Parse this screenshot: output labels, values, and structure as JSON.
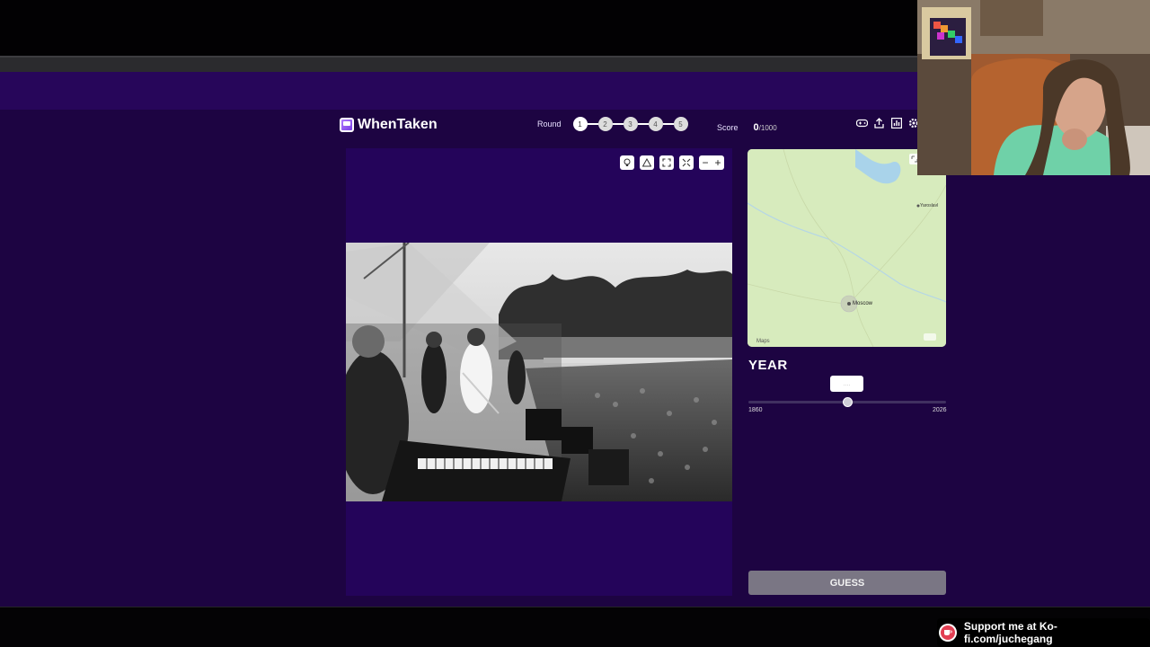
{
  "app": {
    "logo_text": "WhenTaken",
    "round_label": "Round",
    "rounds": [
      "1",
      "2",
      "3",
      "4",
      "5"
    ],
    "current_round": 1,
    "score_label": "Score",
    "score_value": "0",
    "score_max": "/1000"
  },
  "header_icons": [
    "gamepad-icon",
    "share-icon",
    "stats-icon",
    "settings-icon"
  ],
  "photo_tools": [
    "hint-icon",
    "triangle-icon",
    "expand-icon",
    "fullscreen-icon"
  ],
  "zoom": {
    "minus": "−",
    "plus": "+"
  },
  "map": {
    "labels": [
      "Yaroslavl",
      "Moscow"
    ],
    "attribution": "Maps"
  },
  "year_panel": {
    "title": "YEAR",
    "bubble_text": "....",
    "min": "1860",
    "max": "2026",
    "slider_position_fraction": 0.5
  },
  "guess_label": "GUESS",
  "support_text": "Support me at Ko-fi.com/juchegang",
  "colors": {
    "app_bg": "#1d0442",
    "accent": "#7b3fe4",
    "guess_button": "#7a7684",
    "kofi": "#e23f53"
  }
}
